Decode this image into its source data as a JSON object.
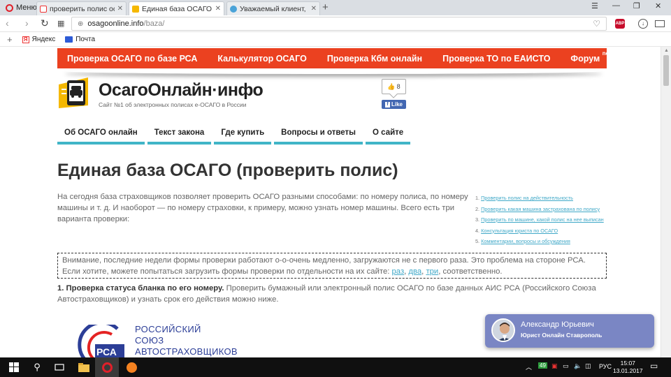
{
  "browser": {
    "menu_label": "Меню",
    "tabs": [
      {
        "title": "проверить полис осаго -",
        "active": false
      },
      {
        "title": "Единая база ОСАГО (пров",
        "active": true
      },
      {
        "title": "Уважаемый клиент, номе",
        "active": false
      }
    ],
    "url_host": "osagoonline.info",
    "url_path": "/baza/",
    "abp_label": "ABP",
    "bookmarks": [
      {
        "label": "Яндекс"
      },
      {
        "label": "Почта"
      }
    ]
  },
  "page": {
    "topnav": [
      "Проверка ОСАГО по базе РСА",
      "Калькулятор ОСАГО",
      "Проверка Кбм онлайн",
      "Проверка ТО по ЕАИСТО",
      "Форум"
    ],
    "topnav_badge": "new",
    "site_title": "ОсагоОнлайн·инфо",
    "site_subtitle": "Сайт №1 об электронных полисах е-ОСАГО в России",
    "like_count": "8",
    "fb_like_label": "Like",
    "main_menu": [
      "Об ОСАГО онлайн",
      "Текст закона",
      "Где купить",
      "Вопросы и ответы",
      "О сайте"
    ],
    "heading": "Единая база ОСАГО (проверить полис)",
    "intro": "На сегодня база страховщиков позволяет проверить ОСАГО разными способами: по номеру полиса, по номеру машины и т. д. И наоборот — по номеру страховки, к примеру, можно узнать номер машины. Всего есть три варианта проверки:",
    "toc": [
      "Проверить полис на действительность",
      "Проверить какая машина застрахована по полису",
      "Проверить по машине, какой полис на нее выписан",
      "Консультация юриста по ОСАГО",
      "Комментарии, вопросы и обсуждения"
    ],
    "notice_text": "Внимание, последние недели формы проверки работают о-о-очень медленно, загружаются не с первого раза. Это проблема на стороне РСА. Если хотите, можете попытаться загрузить формы проверки по отдельности на их сайте: ",
    "notice_links": [
      "раз",
      "два",
      "три"
    ],
    "notice_tail": ", соответственно.",
    "step1_bold": "1. Проверка статуса бланка по его номеру.",
    "step1_text": " Проверить бумажный или электронный полис ОСАГО по базе данных АИС РСА (Российского Союза Автостраховщиков) и узнать срок его действия можно ниже.",
    "rsa_lines": [
      "РОССИЙСКИЙ",
      "СОЮЗ",
      "АВТОСТРАХОВЩИКОВ"
    ],
    "rsa_abbr": "РСА",
    "chat": {
      "name": "Александр Юрьевич",
      "role": "Юрист Онлайн Ставрополь"
    }
  },
  "taskbar": {
    "language": "РУС",
    "time": "15:07",
    "date": "13.01.2017",
    "tray_badge": "49"
  },
  "colors": {
    "topnav_bg": "#eb4120",
    "menu_underline": "#41b5c7",
    "link": "#41a9c8",
    "chat_bg": "#7a86c4",
    "logo_yellow": "#f5b800"
  }
}
